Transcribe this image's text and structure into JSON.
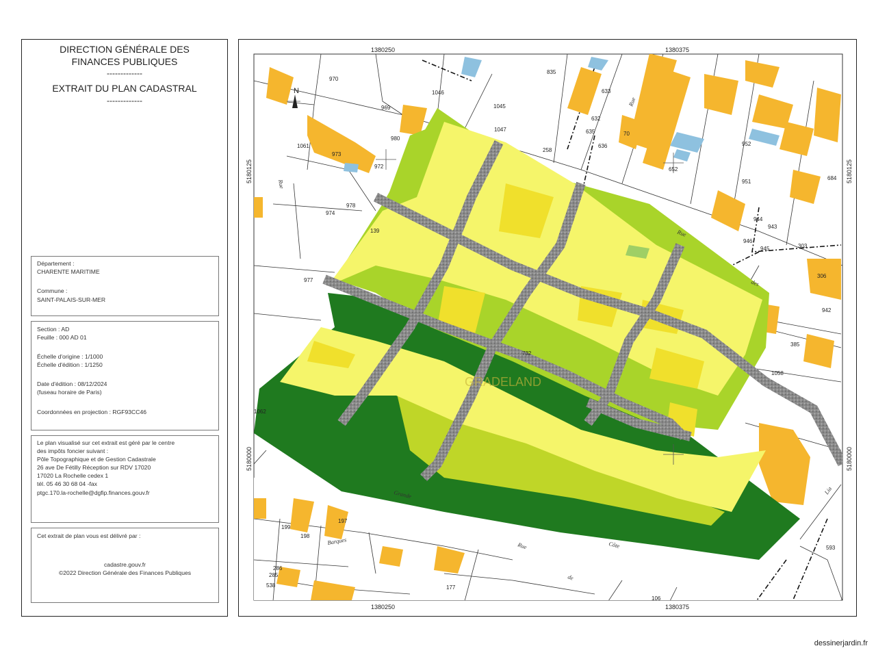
{
  "header": {
    "line1": "DIRECTION GÉNÉRALE DES",
    "line2": "FINANCES PUBLIQUES",
    "sep1": "-------------",
    "line3": "EXTRAIT DU PLAN CADASTRAL",
    "sep2": "-------------"
  },
  "location": {
    "dept_label": "Département :",
    "dept_value": "CHARENTE MARITIME",
    "commune_label": "Commune :",
    "commune_value": "SAINT-PALAIS-SUR-MER"
  },
  "sheet": {
    "section": "Section : AD",
    "feuille": "Feuille : 000 AD 01",
    "echelle_origine": "Échelle d'origine : 1/1000",
    "echelle_edition": "Échelle d'édition : 1/1250",
    "date_edition": "Date d'édition : 08/12/2024",
    "fuseau": "(fuseau horaire de Paris)",
    "coordonnees": "Coordonnées en projection : RGF93CC46"
  },
  "centre": {
    "l1": "Le plan visualisé sur cet extrait est géré par le centre",
    "l2": "des impôts foncier suivant :",
    "l3": "Pôle Topographique et de Gestion Cadastrale",
    "l4": "26 ave De Fétilly Réception sur RDV 17020",
    "l5": "17020 La Rochelle cedex 1",
    "l6": "tél. 05 46 30 68 04 -fax",
    "l7": "ptgc.170.la-rochelle@dgfip.finances.gouv.fr"
  },
  "delivery": {
    "l1": "Cet extrait de plan vous est délivré par :",
    "l2": "cadastre.gouv.fr",
    "l3": "©2022 Direction Générale des Finances Publiques"
  },
  "map": {
    "coords": {
      "top_left": "1380250",
      "top_right": "1380375",
      "bottom_left": "1380250",
      "bottom_right": "1380375",
      "left_top": "5180125",
      "left_bottom": "5180000",
      "right_top": "5180125",
      "right_bottom": "5180000"
    },
    "parcel_labels": [
      "970",
      "969",
      "1046",
      "1045",
      "1047",
      "835",
      "633",
      "632",
      "635",
      "636",
      "70",
      "1061",
      "973",
      "972",
      "980",
      "258",
      "652",
      "952",
      "951",
      "684",
      "974",
      "978",
      "139",
      "977",
      "943",
      "944",
      "945",
      "946",
      "303",
      "306",
      "942",
      "385",
      "1058",
      "732",
      "199",
      "198",
      "197",
      "286",
      "285",
      "538",
      "177",
      "106",
      "593",
      "1062"
    ],
    "street_labels": [
      "Rue",
      "des",
      "Grande",
      "Côte",
      "Rue",
      "de",
      "Barques",
      "Rue",
      "Lia",
      "Rue"
    ],
    "area_label": "GRADELAND",
    "colors": {
      "light_yellow": "#f5f56a",
      "lime": "#a9d42a",
      "dark_green": "#1f7a1f",
      "path_grey": "#8c8c8c",
      "building": "#f5b62e",
      "blue_building": "#8ec1df"
    }
  },
  "footer": "dessinerjardin.fr"
}
